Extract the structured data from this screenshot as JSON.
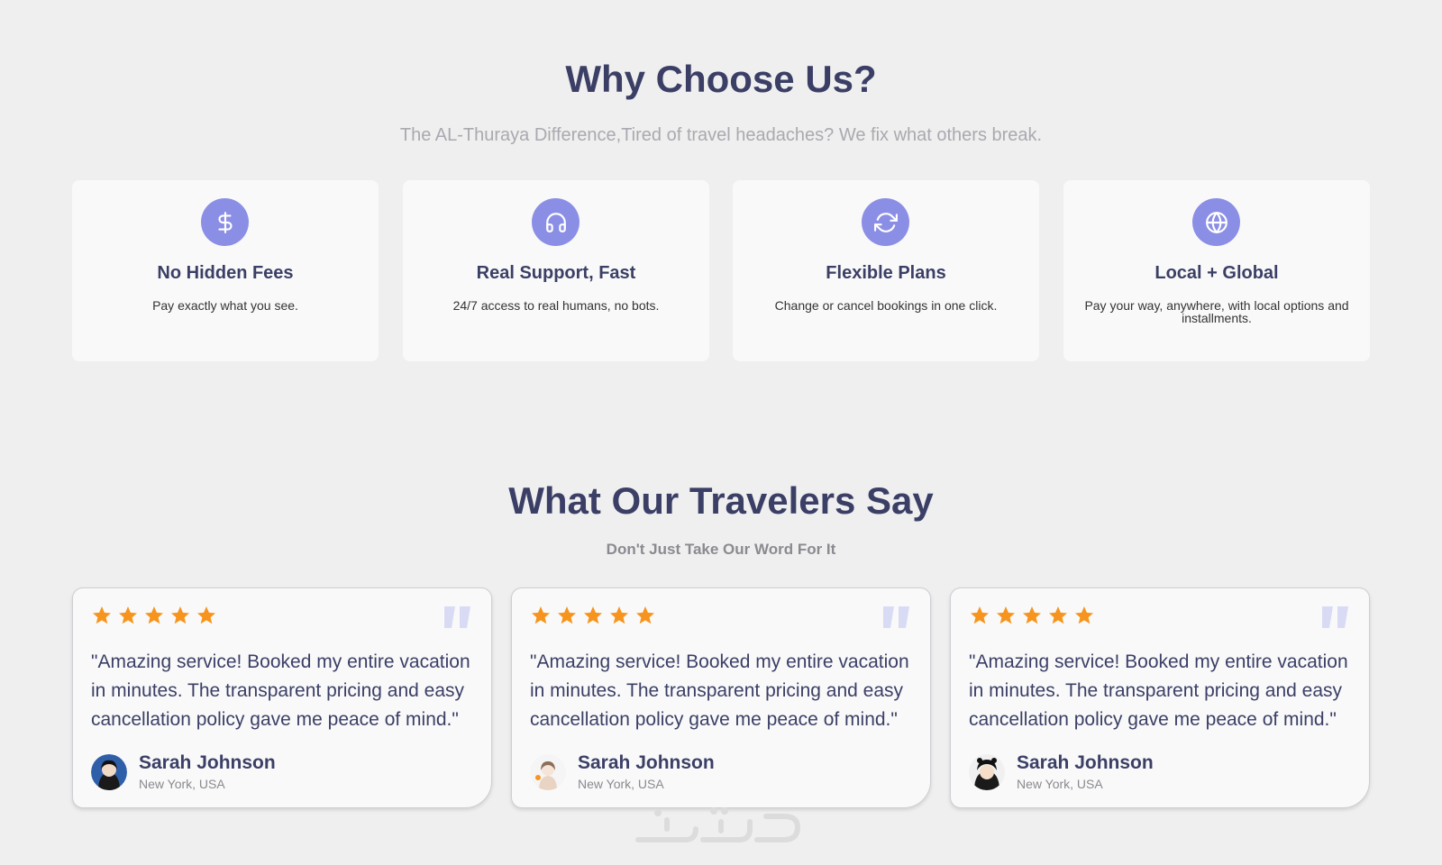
{
  "why": {
    "title": "Why Choose Us?",
    "subtitle": "The AL-Thuraya Difference,Tired of travel headaches? We fix what others break."
  },
  "features": [
    {
      "icon": "dollar-icon",
      "title": "No Hidden Fees",
      "description": "Pay exactly what you see."
    },
    {
      "icon": "headphones-icon",
      "title": "Real Support, Fast",
      "description": "24/7 access to real humans, no bots."
    },
    {
      "icon": "refresh-icon",
      "title": "Flexible Plans",
      "description": "Change or cancel bookings in one click."
    },
    {
      "icon": "globe-icon",
      "title": "Local + Global",
      "description": "Pay your way, anywhere, with local options and installments."
    }
  ],
  "travelers": {
    "title": "What Our Travelers Say",
    "subtitle": "Don't Just Take Our Word For It"
  },
  "reviews": [
    {
      "rating": 5,
      "text": "\"Amazing service! Booked my entire vacation in minutes. The transparent pricing and easy cancellation policy gave me peace of mind.\"",
      "name": "Sarah Johnson",
      "location": "New York, USA"
    },
    {
      "rating": 5,
      "text": "\"Amazing service! Booked my entire vacation in minutes. The transparent pricing and easy cancellation policy gave me peace of mind.\"",
      "name": "Sarah Johnson",
      "location": "New York, USA"
    },
    {
      "rating": 5,
      "text": "\"Amazing service! Booked my entire vacation in minutes. The transparent pricing and easy cancellation policy gave me peace of mind.\"",
      "name": "Sarah Johnson",
      "location": "New York, USA"
    }
  ],
  "colors": {
    "heading": "#3b3f66",
    "icon_bg": "#8b8ee5",
    "star": "#f7941d",
    "quote": "#d9dbf5",
    "background": "#efefef"
  }
}
